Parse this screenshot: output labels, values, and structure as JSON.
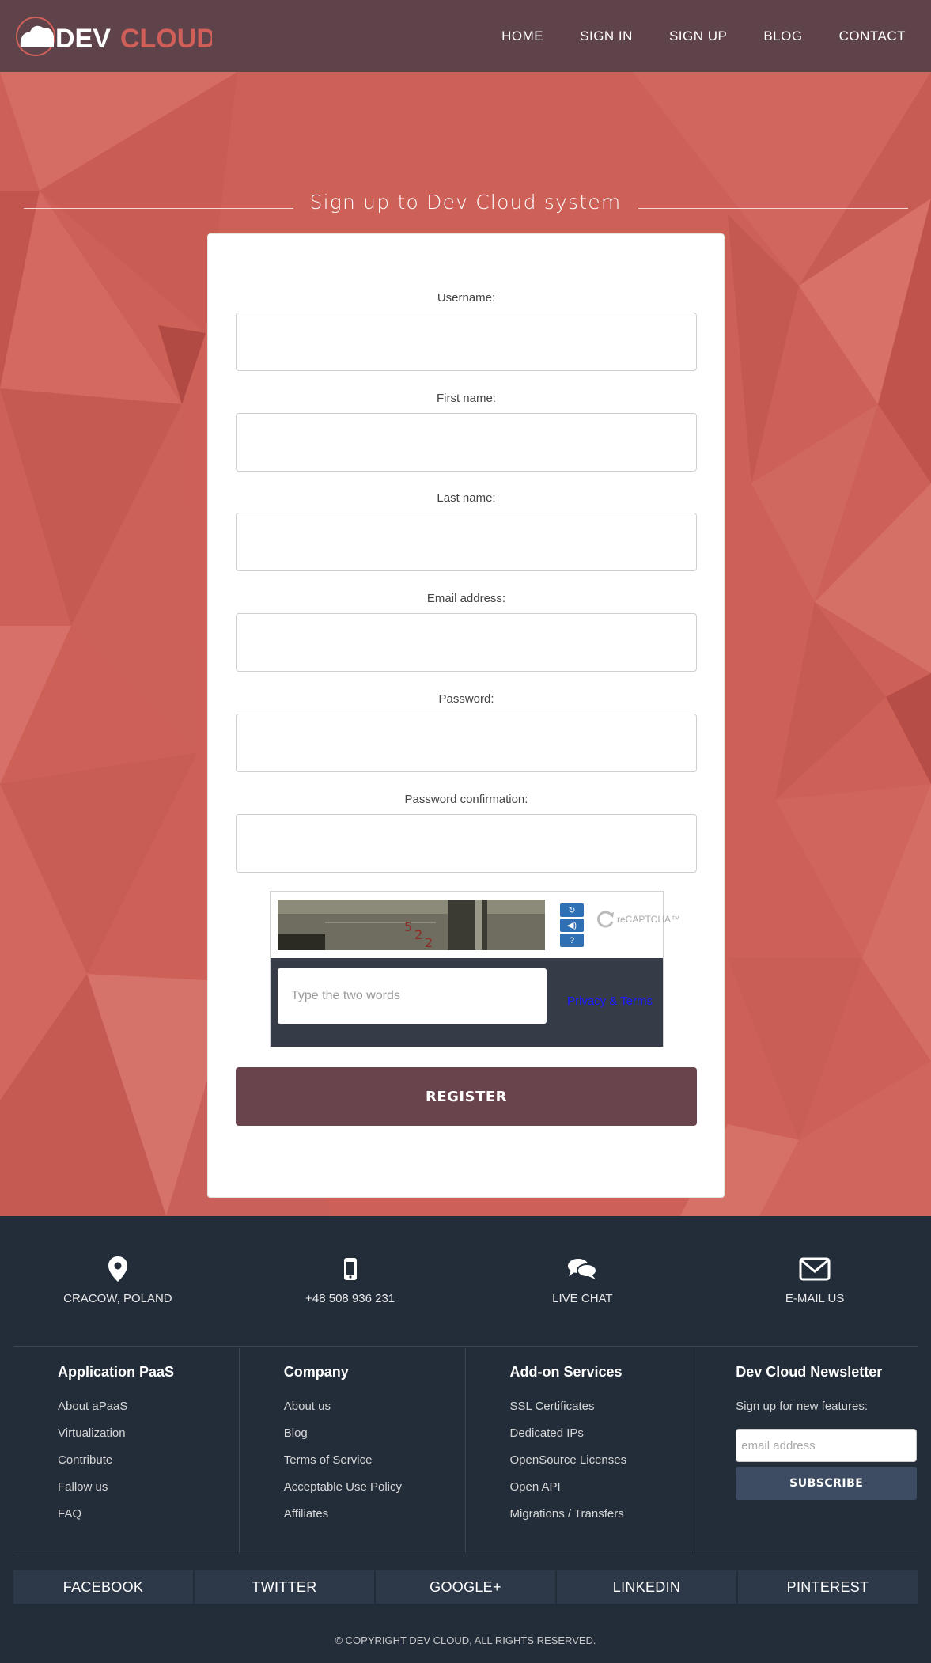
{
  "header": {
    "logo_text_1": "DEV",
    "logo_text_2": "CLOUD",
    "nav": [
      "HOME",
      "SIGN IN",
      "SIGN UP",
      "BLOG",
      "CONTACT"
    ]
  },
  "form": {
    "title": "Sign up to Dev Cloud system",
    "fields": [
      {
        "label": "Username:"
      },
      {
        "label": "First name:"
      },
      {
        "label": "Last name:"
      },
      {
        "label": "Email address:"
      },
      {
        "label": "Password:"
      },
      {
        "label": "Password confirmation:"
      }
    ],
    "captcha": {
      "placeholder": "Type the two words",
      "privacy_link": "Privacy & Terms",
      "brand": "reCAPTCHA™",
      "refresh_icon": "refresh-icon",
      "audio_icon": "audio-icon",
      "help_icon": "help-icon"
    },
    "register_label": "REGISTER"
  },
  "footer": {
    "contacts": [
      {
        "icon": "map-pin-icon",
        "label": "CRACOW, POLAND"
      },
      {
        "icon": "phone-icon",
        "label": "+48 508 936 231"
      },
      {
        "icon": "chat-icon",
        "label": "LIVE CHAT"
      },
      {
        "icon": "envelope-icon",
        "label": "E-MAIL US"
      }
    ],
    "columns": [
      {
        "title": "Application PaaS",
        "items": [
          "About aPaaS",
          "Virtualization",
          "Contribute",
          "Fallow us",
          "FAQ"
        ]
      },
      {
        "title": "Company",
        "items": [
          "About us",
          "Blog",
          "Terms of Service",
          "Acceptable Use Policy",
          "Affiliates"
        ]
      },
      {
        "title": "Add-on Services",
        "items": [
          "SSL Certificates",
          "Dedicated IPs",
          "OpenSource Licenses",
          "Open API",
          "Migrations / Transfers"
        ]
      }
    ],
    "newsletter": {
      "title": "Dev Cloud Newsletter",
      "text": "Sign up for new features:",
      "placeholder": "email address",
      "button": "SUBSCRIBE"
    },
    "social": [
      "FACEBOOK",
      "TWITTER",
      "GOOGLE+",
      "LINKEDIN",
      "PINTEREST"
    ],
    "copyright": "© COPYRIGHT DEV CLOUD, ALL RIGHTS RESERVED."
  }
}
